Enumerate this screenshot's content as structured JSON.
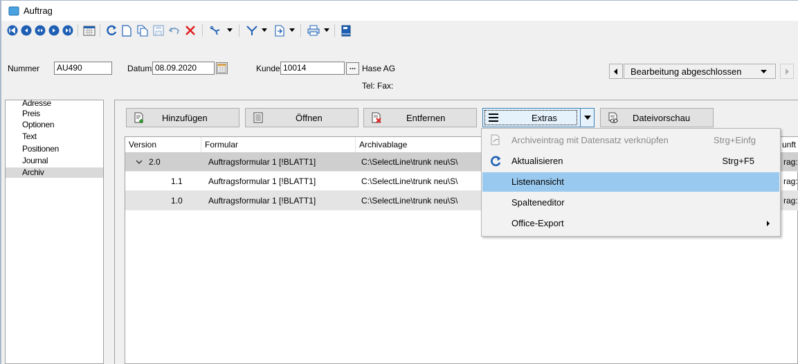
{
  "window": {
    "title": "Auftrag"
  },
  "header": {
    "nummer_label": "Nummer",
    "nummer_value": "AU490",
    "datum_label": "Datum",
    "datum_value": "08.09.2020",
    "kunde_label": "Kunde",
    "kunde_value": "10014",
    "kunde_name": "Hase AG",
    "tel_fax": "Tel:  Fax:",
    "status": "Bearbeitung abgeschlossen"
  },
  "sidebar": {
    "items": [
      {
        "label": "Adresse"
      },
      {
        "label": "Preis"
      },
      {
        "label": "Optionen"
      },
      {
        "label": "Text"
      },
      {
        "label": "Positionen"
      },
      {
        "label": "Journal"
      },
      {
        "label": "Archiv"
      }
    ]
  },
  "buttons": {
    "add": "Hinzufügen",
    "open": "Öffnen",
    "remove": "Entfernen",
    "extras": "Extras",
    "preview": "Dateivorschau"
  },
  "grid": {
    "columns": [
      "Version",
      "Formular",
      "Archivablage",
      "unft"
    ],
    "rows": [
      {
        "version": "2.0",
        "formular": "Auftragsformular 1 [!BLATT1]",
        "ablage": "C:\\SelectLine\\trunk neu\\S\\",
        "herkunft": "rag:"
      },
      {
        "version": "1.1",
        "formular": "Auftragsformular 1 [!BLATT1]",
        "ablage": "C:\\SelectLine\\trunk neu\\S\\",
        "herkunft": "rag:"
      },
      {
        "version": "1.0",
        "formular": "Auftragsformular 1 [!BLATT1]",
        "ablage": "C:\\SelectLine\\trunk neu\\S\\",
        "herkunft": "rag:"
      }
    ]
  },
  "menu": {
    "items": [
      {
        "label": "Archiveintrag mit Datensatz verknüpfen",
        "shortcut": "Strg+Einfg",
        "disabled": true
      },
      {
        "label": "Aktualisieren",
        "shortcut": "Strg+F5"
      },
      {
        "label": "Listenansicht",
        "highlighted": true
      },
      {
        "label": "Spalteneditor"
      },
      {
        "label": "Office-Export",
        "submenu": true
      }
    ]
  },
  "colors": {
    "accent": "#1e5fb4",
    "highlight": "#99c9ef",
    "selected_row": "#cfcfcf",
    "delete_red": "#e02020"
  },
  "icons": [
    "first-icon",
    "prev-icon",
    "play-icon",
    "next-icon",
    "last-icon",
    "calendar-icon",
    "refresh-icon",
    "new-doc-icon",
    "copy-icon",
    "save-icon",
    "undo-icon",
    "delete-icon",
    "tools-icon",
    "filter-icon",
    "export-icon",
    "print-icon",
    "book-icon"
  ]
}
